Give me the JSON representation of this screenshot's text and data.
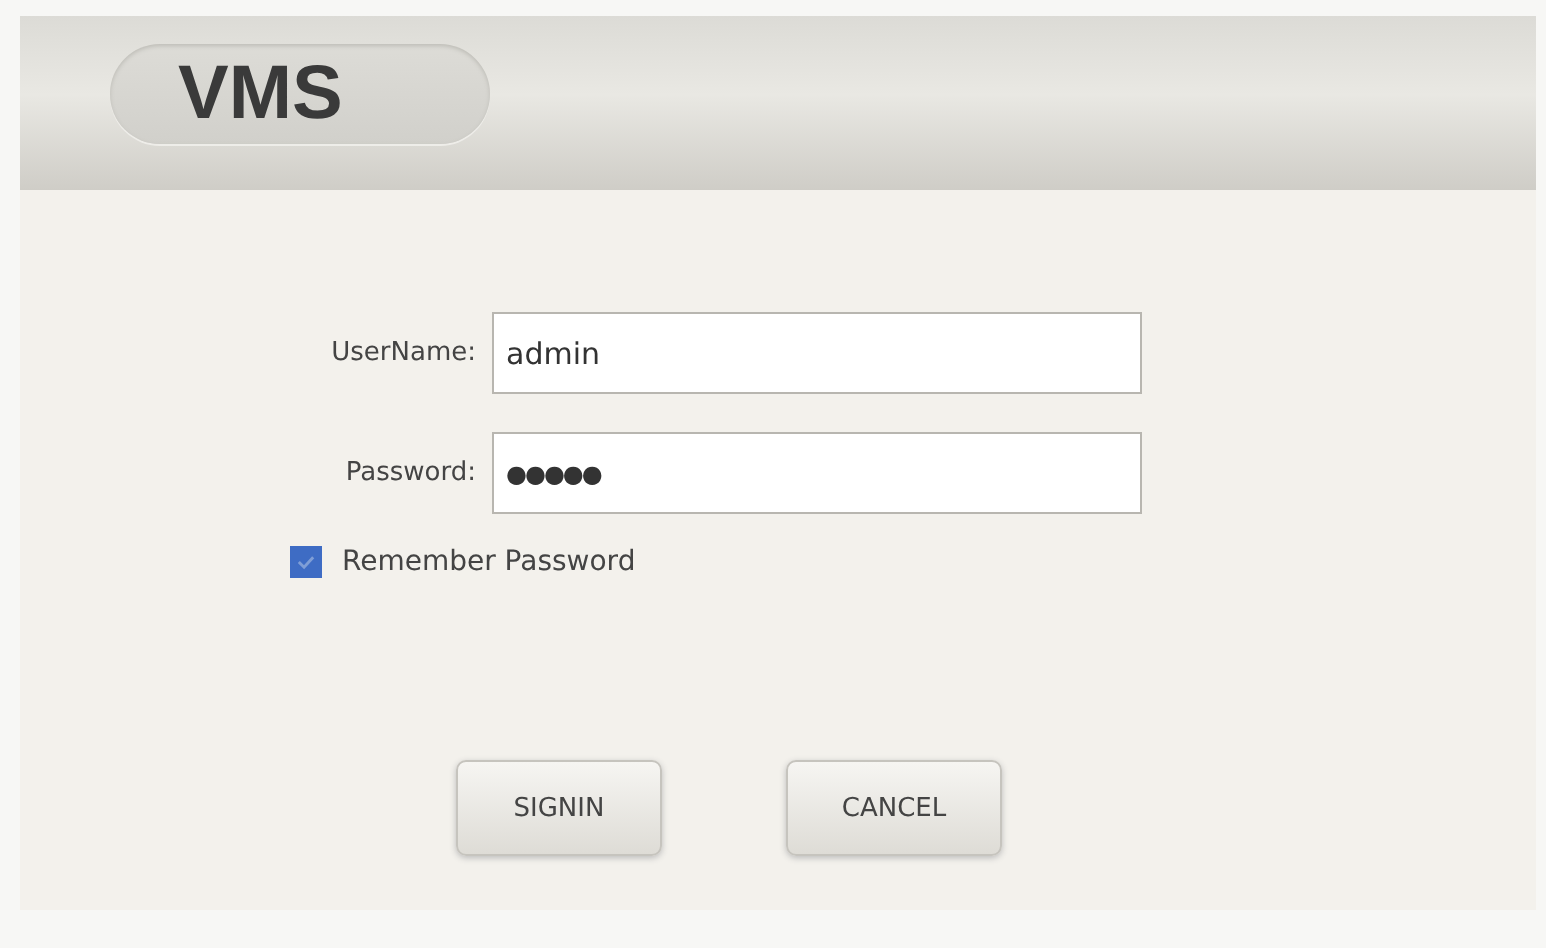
{
  "window": {
    "title": "VMS"
  },
  "fields": [
    {
      "label": "UserName:",
      "value": "admin"
    },
    {
      "label": "Password:",
      "value": "●●●●●"
    }
  ],
  "remember": {
    "label": "Remember Password",
    "checked": true
  },
  "buttons": [
    "SIGNIN",
    "CANCEL"
  ]
}
